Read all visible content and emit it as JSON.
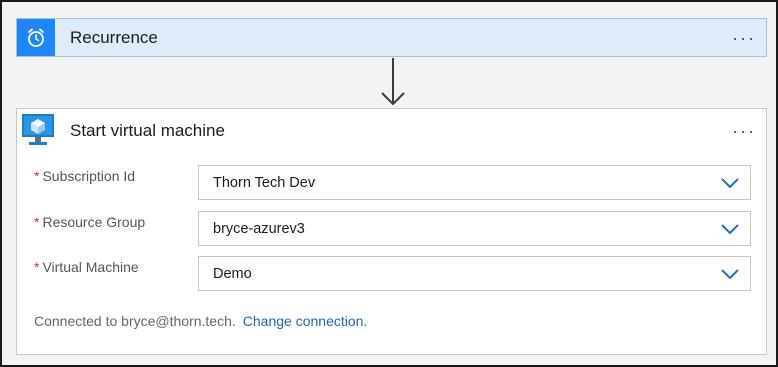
{
  "trigger": {
    "title": "Recurrence",
    "icon": "alarm-clock-icon",
    "more_label": "···",
    "colors": {
      "header_bg": "#deebf8",
      "icon_bg": "#1f85ff"
    }
  },
  "action": {
    "title": "Start virtual machine",
    "icon": "azure-vm-icon",
    "more_label": "···",
    "fields": [
      {
        "required_mark": "*",
        "label": "Subscription Id",
        "value": "Thorn Tech Dev"
      },
      {
        "required_mark": "*",
        "label": "Resource Group",
        "value": "bryce-azurev3"
      },
      {
        "required_mark": "*",
        "label": "Virtual Machine",
        "value": "Demo"
      }
    ],
    "connection": {
      "text": "Connected to bryce@thorn.tech.",
      "link": "Change connection."
    },
    "colors": {
      "required": "#c0392b",
      "link": "#2266aa",
      "chevron": "#1f6fc4"
    }
  }
}
